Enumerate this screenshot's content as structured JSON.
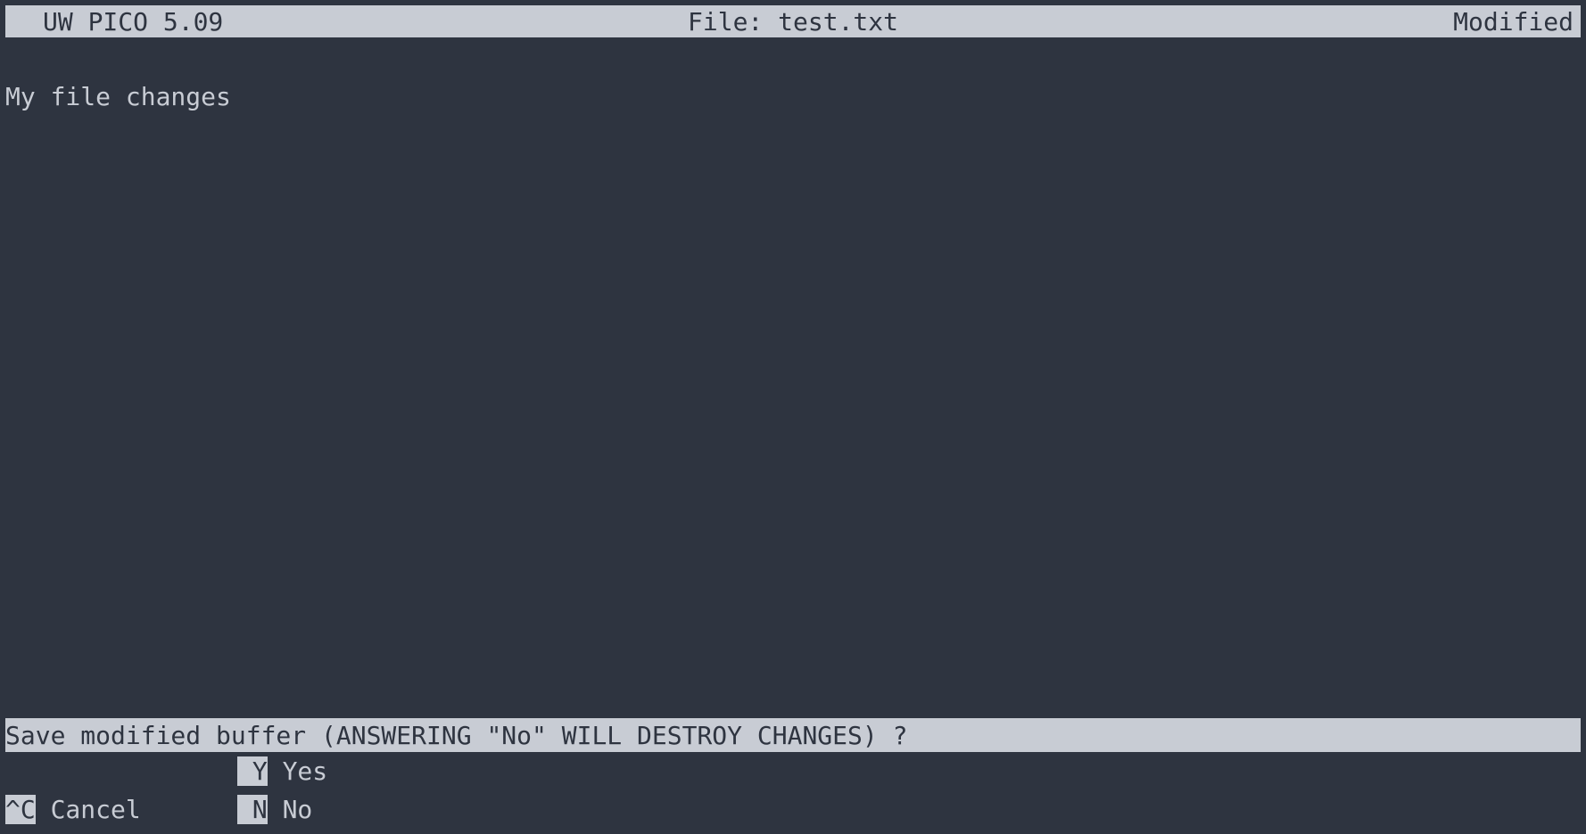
{
  "titlebar": {
    "app_name": "UW PICO 5.09",
    "file_label": "File: test.txt",
    "status": "Modified"
  },
  "editor": {
    "content": "My file changes"
  },
  "prompt": {
    "text": "Save modified buffer (ANSWERING \"No\" WILL DESTROY CHANGES) ? "
  },
  "shortcuts": {
    "row1": {
      "col1_key": "",
      "col1_label": "",
      "col2_key": " Y",
      "col2_label": " Yes"
    },
    "row2": {
      "col1_key": "^C",
      "col1_label": " Cancel",
      "col2_key": " N",
      "col2_label": " No"
    }
  }
}
